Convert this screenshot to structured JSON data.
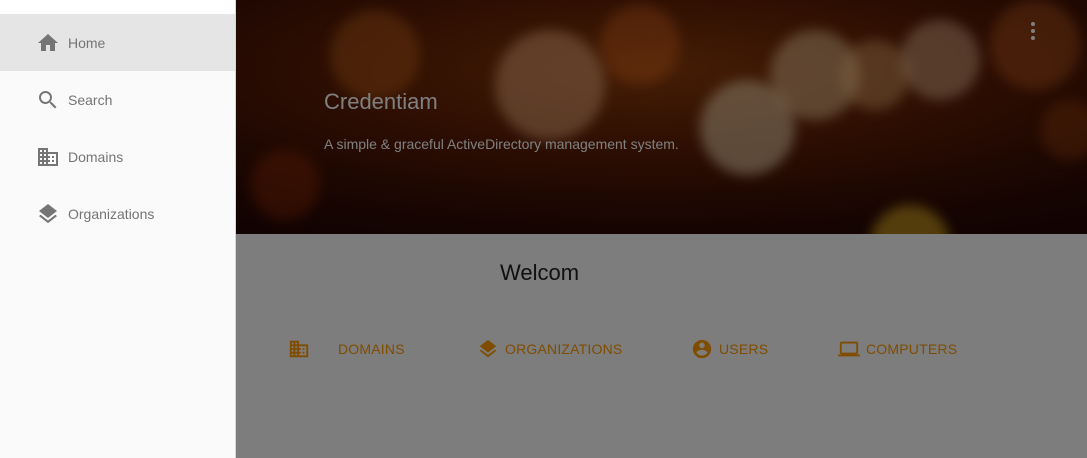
{
  "drawer": {
    "items": [
      {
        "label": "Home",
        "icon": "home-icon",
        "active": true
      },
      {
        "label": "Search",
        "icon": "search-icon",
        "active": false
      },
      {
        "label": "Domains",
        "icon": "domain-icon",
        "active": false
      },
      {
        "label": "Organizations",
        "icon": "layers-icon",
        "active": false
      }
    ]
  },
  "hero": {
    "title": "Credentiam",
    "subtitle": "A simple & graceful ActiveDirectory management system."
  },
  "main": {
    "welcome": "Welcom",
    "quick_links": [
      {
        "label": "DOMAINS",
        "icon": "domain-icon"
      },
      {
        "label": "ORGANIZATIONS",
        "icon": "layers-icon"
      },
      {
        "label": "USERS",
        "icon": "account-circle-icon"
      },
      {
        "label": "COMPUTERS",
        "icon": "laptop-icon"
      }
    ]
  },
  "colors": {
    "accent": "#ff9800",
    "scrim": "rgba(0,0,0,0.5)",
    "drawer_bg": "#fafafa",
    "active_item_bg": "#e5e5e5",
    "nav_text": "#757575"
  }
}
